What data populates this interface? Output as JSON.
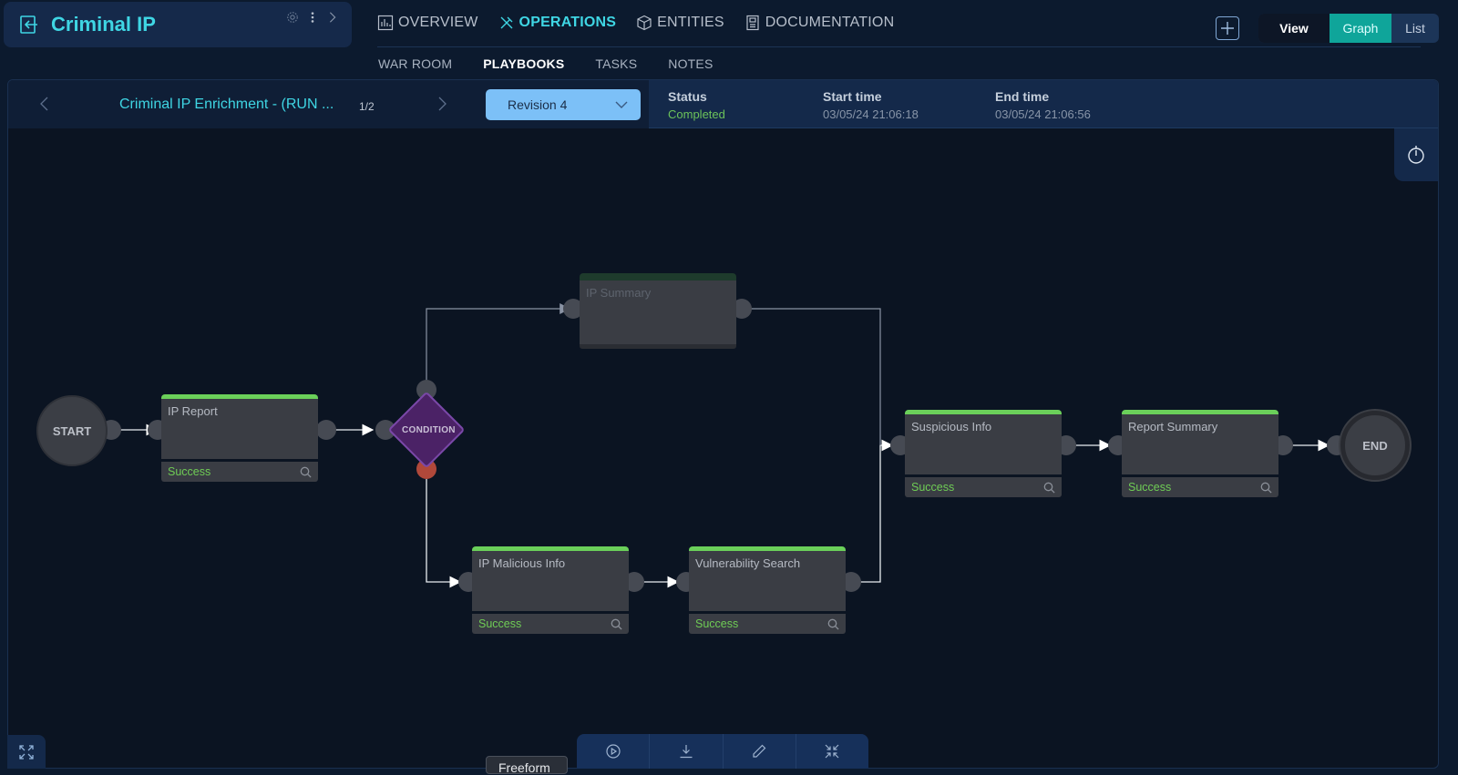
{
  "app": {
    "title": "Criminal IP",
    "icons": [
      "exit-icon",
      "gear-icon",
      "kebab-menu-icon",
      "chevron-right-icon"
    ]
  },
  "nav": {
    "tabs": [
      {
        "label": "OVERVIEW",
        "icon": "bar-chart-icon",
        "active": false
      },
      {
        "label": "OPERATIONS",
        "icon": "tools-icon",
        "active": true
      },
      {
        "label": "ENTITIES",
        "icon": "cube-icon",
        "active": false
      },
      {
        "label": "DOCUMENTATION",
        "icon": "document-icon",
        "active": false
      }
    ],
    "subtabs": [
      {
        "label": "WAR ROOM",
        "active": false
      },
      {
        "label": "PLAYBOOKS",
        "active": true
      },
      {
        "label": "TASKS",
        "active": false
      },
      {
        "label": "NOTES",
        "active": false
      }
    ]
  },
  "view_toggle": {
    "label": "View",
    "options": [
      "Graph",
      "List"
    ],
    "selected": "Graph"
  },
  "run": {
    "name": "Criminal IP Enrichment - (RUN ...",
    "counter": "1/2",
    "revision": "Revision 4",
    "status_label": "Status",
    "status_value": "Completed",
    "start_label": "Start time",
    "start_value": "03/05/24 21:06:18",
    "end_label": "End time",
    "end_value": "03/05/24 21:06:56"
  },
  "graph": {
    "start_label": "START",
    "end_label": "END",
    "condition_label": "CONDITION",
    "nodes": [
      {
        "id": "ip-report",
        "title": "IP Report",
        "status": "Success",
        "executed": true
      },
      {
        "id": "ip-summary",
        "title": "IP Summary",
        "status": "",
        "executed": false
      },
      {
        "id": "ip-malicious-info",
        "title": "IP Malicious Info",
        "status": "Success",
        "executed": true
      },
      {
        "id": "vulnerability-search",
        "title": "Vulnerability Search",
        "status": "Success",
        "executed": true
      },
      {
        "id": "suspicious-info",
        "title": "Suspicious Info",
        "status": "Success",
        "executed": true
      },
      {
        "id": "report-summary",
        "title": "Report Summary",
        "status": "Success",
        "executed": true
      }
    ]
  },
  "toolbar": {
    "buttons": [
      "play-icon",
      "download-icon",
      "edit-icon",
      "collapse-icon"
    ],
    "tooltip": "Freeform"
  },
  "colors": {
    "accent": "#3fd6e4",
    "success": "#6cc35a",
    "graph_active": "#0fa59a",
    "revision_bg": "#7cc0f7",
    "condition": "#4b2266"
  }
}
